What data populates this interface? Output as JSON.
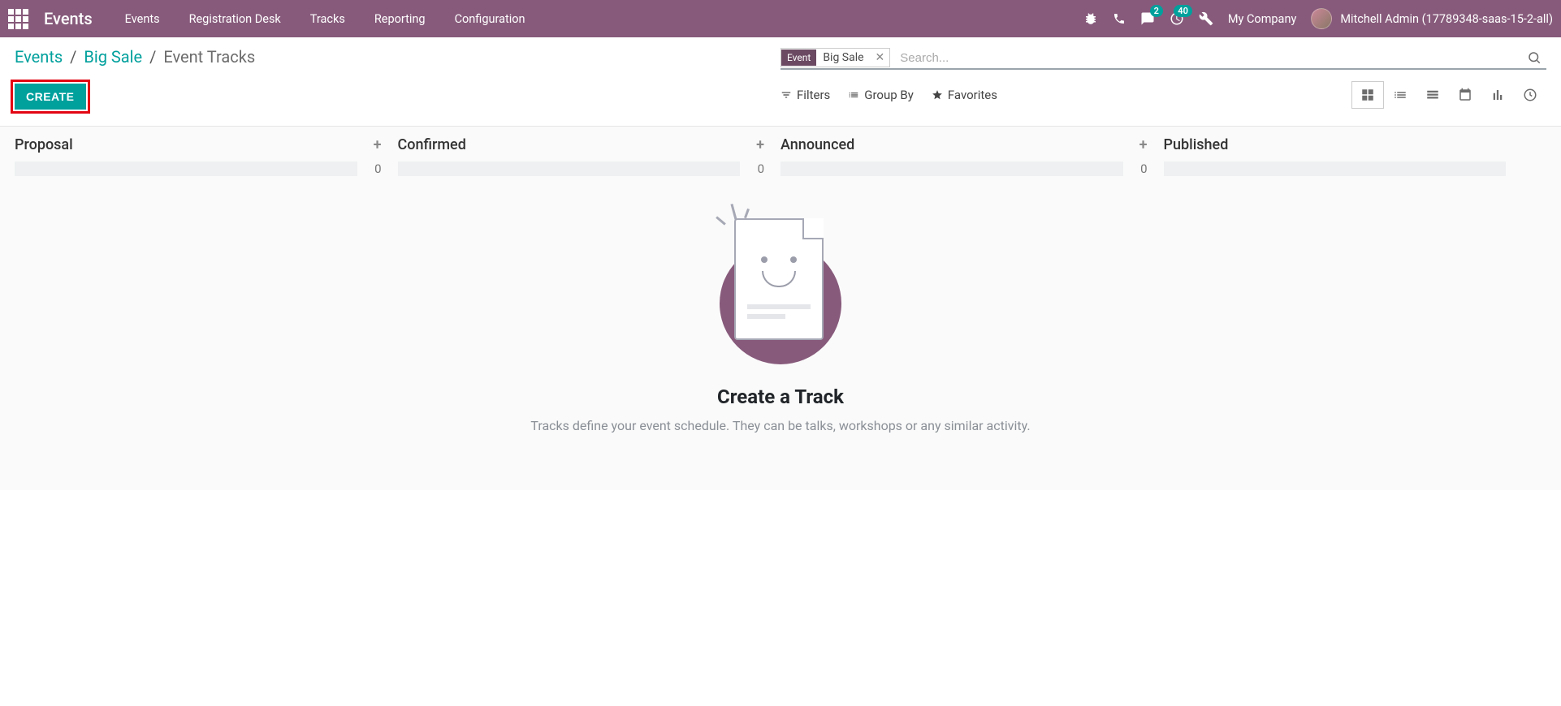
{
  "navbar": {
    "app_name": "Events",
    "menu": [
      "Events",
      "Registration Desk",
      "Tracks",
      "Reporting",
      "Configuration"
    ],
    "messages_badge": "2",
    "activities_badge": "40",
    "company": "My Company",
    "user": "Mitchell Admin (17789348-saas-15-2-all)"
  },
  "breadcrumb": {
    "root": "Events",
    "parent": "Big Sale",
    "current": "Event Tracks"
  },
  "buttons": {
    "create": "CREATE"
  },
  "search": {
    "tag_type": "Event",
    "tag_value": "Big Sale",
    "placeholder": "Search..."
  },
  "toolbar": {
    "filters": "Filters",
    "group_by": "Group By",
    "favorites": "Favorites"
  },
  "kanban": {
    "columns": [
      {
        "title": "Proposal",
        "count": "0",
        "has_add": true
      },
      {
        "title": "Confirmed",
        "count": "0",
        "has_add": true
      },
      {
        "title": "Announced",
        "count": "0",
        "has_add": true
      },
      {
        "title": "Published",
        "count": "",
        "has_add": false
      }
    ]
  },
  "empty": {
    "title": "Create a Track",
    "desc": "Tracks define your event schedule. They can be talks, workshops or any similar activity."
  }
}
